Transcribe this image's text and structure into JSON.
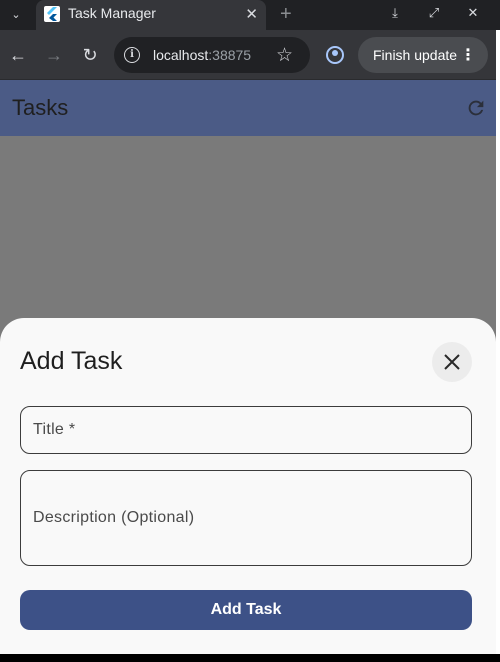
{
  "browser": {
    "tab": {
      "title": "Task Manager",
      "favicon_icon": "flutter-icon",
      "close_icon": "close-icon"
    },
    "new_tab_icon": "plus-icon",
    "window_controls": [
      "download-icon",
      "maximize-icon",
      "close-icon"
    ],
    "toolbar": {
      "back_icon": "back-arrow-icon",
      "forward_icon": "forward-arrow-icon",
      "reload_icon": "reload-icon",
      "url_host": "localhost",
      "url_port": ":38875",
      "bookmark_icon": "star-icon",
      "profile_icon": "profile-icon",
      "update_label": "Finish update",
      "menu_icon": "kebab-menu-icon"
    }
  },
  "app": {
    "title": "Tasks",
    "refresh_icon": "refresh-icon",
    "colors": {
      "app_bar": "#4b5b86",
      "primary_button": "#3d5187"
    }
  },
  "sheet": {
    "title": "Add Task",
    "close_icon": "close-icon",
    "title_field": {
      "label": "Title *",
      "value": ""
    },
    "description_field": {
      "label": "Description (Optional)",
      "value": ""
    },
    "submit_label": "Add Task"
  }
}
